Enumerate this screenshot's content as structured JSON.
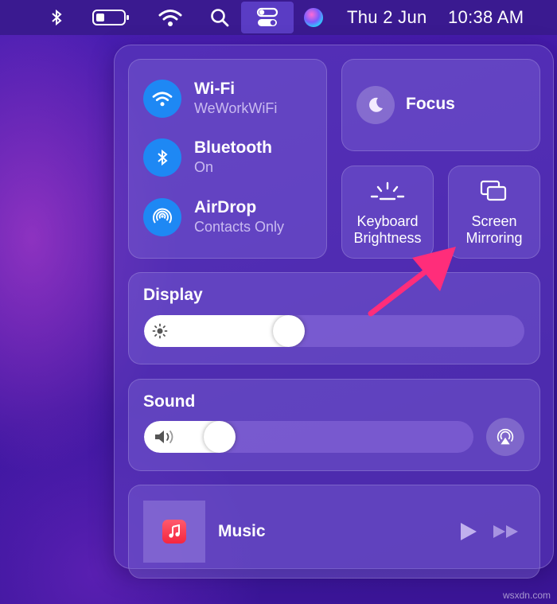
{
  "menubar": {
    "date": "Thu 2 Jun",
    "time": "10:38 AM",
    "icons": [
      "bluetooth-icon",
      "battery-icon",
      "wifi-icon",
      "search-icon",
      "control-center-icon",
      "siri-icon"
    ]
  },
  "connectivity": {
    "items": [
      {
        "title": "Wi-Fi",
        "subtitle": "WeWorkWiFi",
        "icon": "wifi-icon"
      },
      {
        "title": "Bluetooth",
        "subtitle": "On",
        "icon": "bluetooth-icon"
      },
      {
        "title": "AirDrop",
        "subtitle": "Contacts Only",
        "icon": "airdrop-icon"
      }
    ]
  },
  "focus": {
    "label": "Focus",
    "icon": "moon-icon"
  },
  "keyboard_brightness": {
    "line1": "Keyboard",
    "line2": "Brightness",
    "icon": "keyboard-brightness-icon"
  },
  "screen_mirroring": {
    "line1": "Screen",
    "line2": "Mirroring",
    "icon": "screen-mirroring-icon"
  },
  "display": {
    "label": "Display",
    "level": 0.37,
    "icon": "sun-icon"
  },
  "sound": {
    "label": "Sound",
    "level": 0.2,
    "icon": "speaker-icon",
    "output_icon": "airplay-audio-icon"
  },
  "music": {
    "label": "Music",
    "icons": [
      "music-app-icon",
      "play-icon",
      "fast-forward-icon"
    ]
  },
  "annotation": {
    "color": "#ff2d7a",
    "points_to": "screen_mirroring"
  },
  "colors": {
    "accent": "#1e88f4",
    "panel": "#5c3ebe",
    "arrow": "#ff2d7a"
  },
  "watermark": "wsxdn.com"
}
